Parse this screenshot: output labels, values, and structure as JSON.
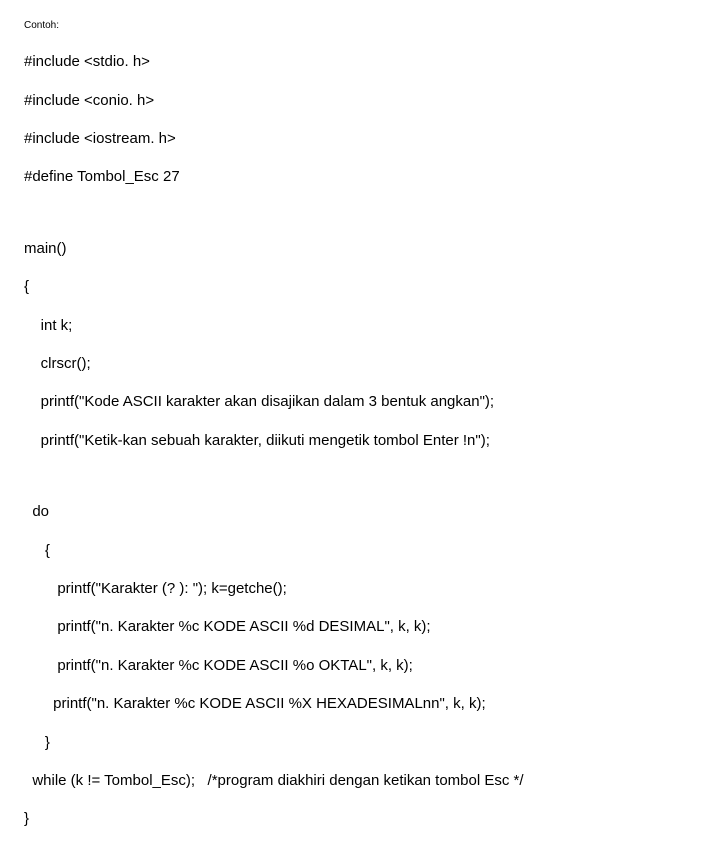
{
  "label": "Contoh:",
  "lines": {
    "l0": "#include <stdio. h>",
    "l1": "#include <conio. h>",
    "l2": "#include <iostream. h>",
    "l3": "#define Tombol_Esc 27",
    "l4": "main()",
    "l5": "{",
    "l6": "    int k;",
    "l7": "    clrscr();",
    "l8": "    printf(\"Kode ASCII karakter akan disajikan dalam 3 bentuk angkan\");",
    "l9": "    printf(\"Ketik-kan sebuah karakter, diikuti mengetik tombol Enter !n\");",
    "l10": "  do",
    "l11": "     {",
    "l12": "        printf(\"Karakter (? ): \"); k=getche();",
    "l13": "        printf(\"n. Karakter %c KODE ASCII %d DESIMAL\", k, k);",
    "l14": "        printf(\"n. Karakter %c KODE ASCII %o OKTAL\", k, k);",
    "l15": "       printf(\"n. Karakter %c KODE ASCII %X HEXADESIMALnn\", k, k);",
    "l16": "     }",
    "l17": "  while (k != Tombol_Esc);   /*program diakhiri dengan ketikan tombol Esc */",
    "l18": "}"
  }
}
